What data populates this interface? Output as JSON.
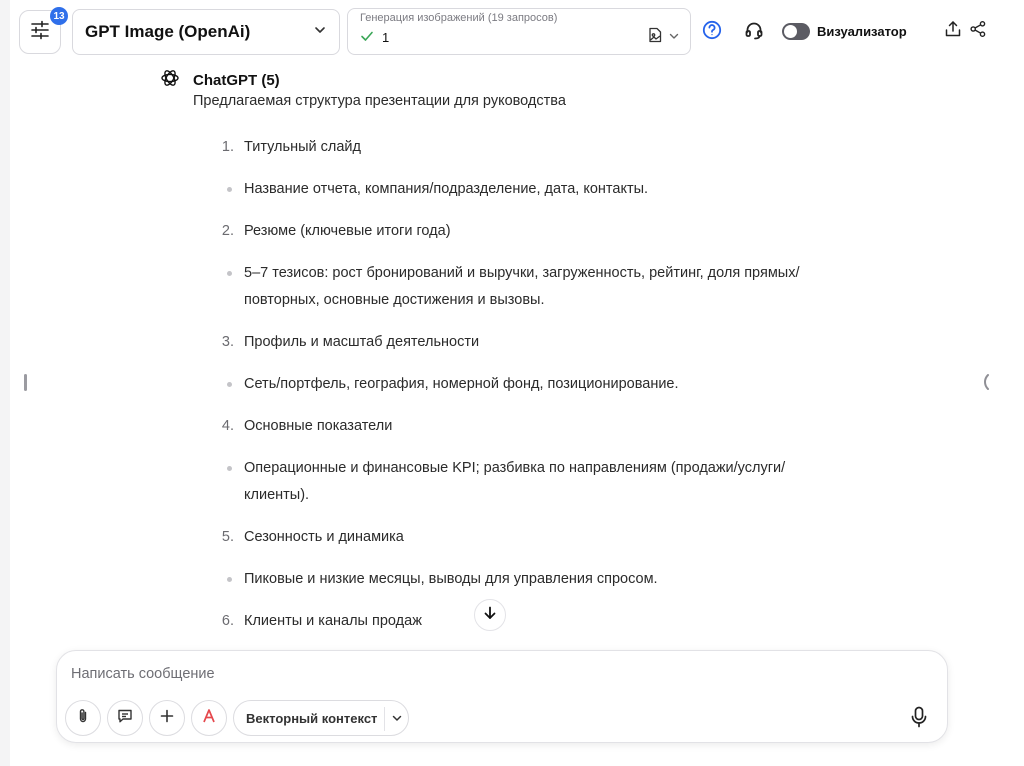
{
  "header": {
    "settings_badge": "13",
    "model": {
      "label": "GPT Image (OpenAi)"
    },
    "generation": {
      "title": "Генерация изображений (19 запросов)",
      "value": "1"
    },
    "toggle": {
      "label": "Визуализатор",
      "on": false
    }
  },
  "message": {
    "author": "ChatGPT (5)",
    "intro": "Предлагаемая структура презентации для руководства",
    "outline": [
      {
        "type": "numbered",
        "marker": "1.",
        "text": "Титульный слайд"
      },
      {
        "type": "bullet",
        "text": "Название отчета, компания/подразделение, дата, контакты."
      },
      {
        "type": "numbered",
        "marker": "2.",
        "text": "Резюме (ключевые итоги года)"
      },
      {
        "type": "bullet",
        "text": "5–7 тезисов: рост бронирований и выручки, загруженность, рейтинг, доля прямых/повторных, основные достижения и вызовы."
      },
      {
        "type": "numbered",
        "marker": "3.",
        "text": "Профиль и масштаб деятельности"
      },
      {
        "type": "bullet",
        "text": "Сеть/портфель, география, номерной фонд, позиционирование."
      },
      {
        "type": "numbered",
        "marker": "4.",
        "text": "Основные показатели"
      },
      {
        "type": "bullet",
        "text": "Операционные и финансовые KPI; разбивка по направлениям (продажи/услуги/клиенты)."
      },
      {
        "type": "numbered",
        "marker": "5.",
        "text": "Сезонность и динамика"
      },
      {
        "type": "bullet",
        "text": "Пиковые и низкие месяцы, выводы для управления спросом."
      },
      {
        "type": "numbered",
        "marker": "6.",
        "text": "Клиенты и каналы продаж"
      }
    ]
  },
  "composer": {
    "placeholder": "Написать сообщение",
    "value": "",
    "context_label": "Векторный контекст"
  },
  "colors": {
    "accent": "#2f6fea",
    "help_icon": "#2563eb",
    "attach_red": "#e5484d"
  }
}
